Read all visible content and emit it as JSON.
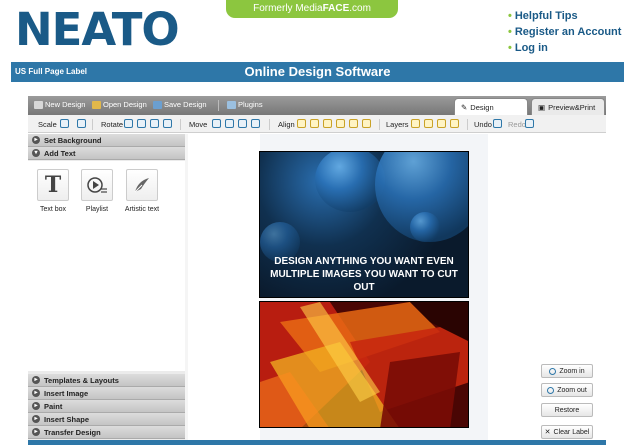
{
  "header": {
    "logo_text": "NEATO",
    "formerly_prefix": "Formerly Media",
    "formerly_brand": "FACE",
    "formerly_suffix": ".com",
    "links": [
      "Helpful Tips",
      "Register an Account",
      "Log in"
    ],
    "label_small": "US Full Page Label",
    "title": "Online Design Software"
  },
  "menubar": {
    "items": [
      "New Design",
      "Open Design",
      "Save Design",
      "Plugins"
    ],
    "tabs": [
      "Design",
      "Preview&Print"
    ]
  },
  "toolbar": {
    "scale": "Scale",
    "rotate": "Rotate",
    "move": "Move",
    "align": "Align",
    "layers": "Layers",
    "undo": "Undo",
    "redo": "Redo"
  },
  "left_panel": {
    "top_sections": [
      "Set Background",
      "Add Text"
    ],
    "tools": [
      "Text box",
      "Playlist",
      "Artistic text"
    ],
    "bottom_sections": [
      "Templates & Layouts",
      "Insert Image",
      "Paint",
      "Insert Shape",
      "Transfer Design"
    ]
  },
  "canvas": {
    "caption": "DESIGN ANYTHING YOU WANT EVEN MULTIPLE IMAGES YOU WANT TO CUT OUT"
  },
  "right_buttons": [
    "Zoom in",
    "Zoom out",
    "Restore",
    "Clear Label"
  ],
  "colors": {
    "brand_blue": "#1a5a87",
    "brand_green": "#8cc63f",
    "bar_blue": "#2e77a8"
  }
}
